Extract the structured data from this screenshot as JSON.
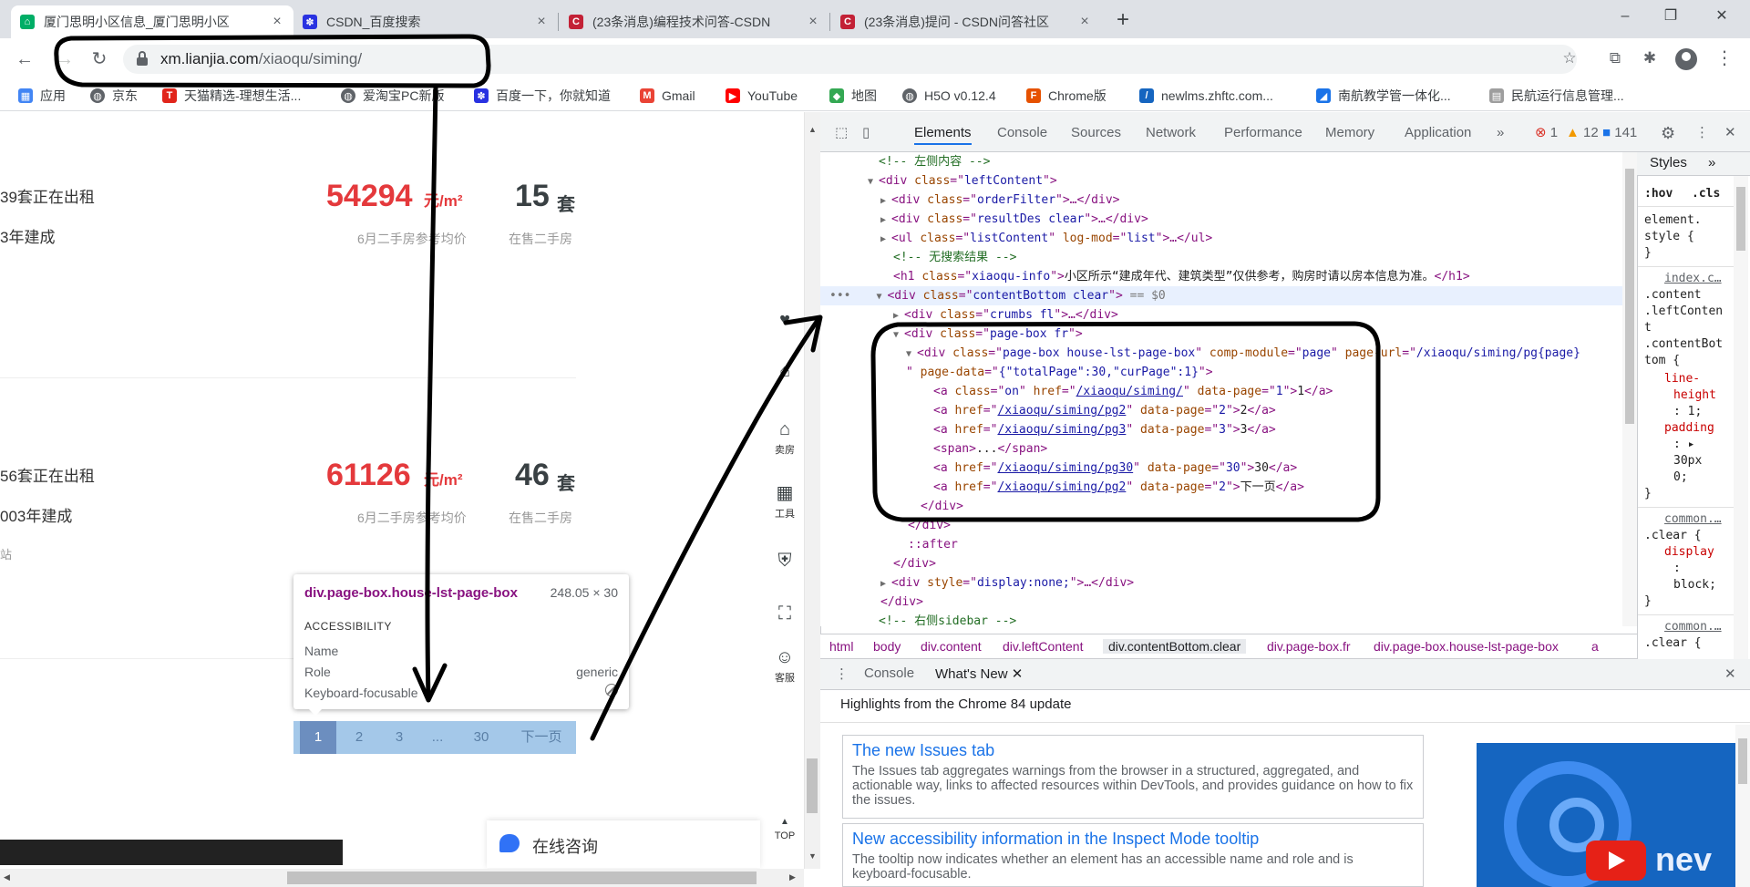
{
  "browser": {
    "tabs": [
      {
        "title": "厦门思明小区信息_厦门思明小区",
        "icon_color": "#00ae66",
        "active": true
      },
      {
        "title": "CSDN_百度搜索",
        "icon_color": "#2932e1",
        "active": false
      },
      {
        "title": "(23条消息)编程技术问答-CSDN",
        "icon_color": "#c32136",
        "active": false
      },
      {
        "title": "(23条消息)提问 - CSDN问答社区",
        "icon_color": "#c32136",
        "active": false
      }
    ],
    "new_tab": "+",
    "win_controls": {
      "minimize": "–",
      "maximize": "❐",
      "close": "✕"
    },
    "nav": {
      "back": "←",
      "forward": "→",
      "reload": "↻"
    },
    "url": {
      "host": "xm.lianjia.com",
      "path": "/xiaoqu/siming/"
    },
    "omnibox_icons": {
      "star": "☆",
      "cast": "⧉",
      "extensions": "✱"
    },
    "menu": "⋮",
    "bookmarks": [
      {
        "label": "应用",
        "icon_color": "#4285f4"
      },
      {
        "label": "京东",
        "icon_color": "#5f6368"
      },
      {
        "label": "天猫精选-理想生活...",
        "icon_color": "#e1251b"
      },
      {
        "label": "爱淘宝PC新版",
        "icon_color": "#5f6368"
      },
      {
        "label": "百度一下，你就知道",
        "icon_color": "#2932e1"
      },
      {
        "label": "Gmail",
        "icon_color": "#ea4335"
      },
      {
        "label": "YouTube",
        "icon_color": "#ff0000"
      },
      {
        "label": "地图",
        "icon_color": "#34a853"
      },
      {
        "label": "H5O v0.12.4",
        "icon_color": "#5f6368"
      },
      {
        "label": "Chrome版",
        "icon_color": "#e65100"
      },
      {
        "label": "newlms.zhftc.com...",
        "icon_color": "#1565c0"
      },
      {
        "label": "南航教学管一体化...",
        "icon_color": "#1a73e8"
      },
      {
        "label": "民航运行信息管理...",
        "icon_color": "#9e9e9e"
      }
    ]
  },
  "page": {
    "listings": [
      {
        "rent": "39套正在出租",
        "year": "3年建成",
        "price": "54294",
        "price_unit": "元/m²",
        "price_label": "6月二手房参考均价",
        "count": "15",
        "count_unit": "套",
        "count_label": "在售二手房"
      },
      {
        "rent": "56套正在出租",
        "year": "003年建成",
        "price": "61126",
        "price_unit": "元/m²",
        "price_label": "6月二手房参考均价",
        "count": "46",
        "count_unit": "套",
        "count_label": "在售二手房",
        "tag": "站"
      }
    ],
    "tooltip": {
      "title": "div.page-box.house-lst-page-box",
      "size": "248.05 × 30",
      "section": "ACCESSIBILITY",
      "name_label": "Name",
      "role_label": "Role",
      "role_value": "generic",
      "focus_label": "Keyboard-focusable"
    },
    "pager": [
      "1",
      "2",
      "3",
      "...",
      "30",
      "下一页"
    ],
    "sidebar": [
      {
        "icon": "♥",
        "label": ""
      },
      {
        "icon": "⌂",
        "label": ""
      },
      {
        "icon": "⌂",
        "label": "卖房"
      },
      {
        "icon": "▦",
        "label": "工具"
      },
      {
        "icon": "⛨",
        "label": ""
      },
      {
        "icon": "⛶",
        "label": ""
      },
      {
        "icon": "☺",
        "label": "客服"
      },
      {
        "icon": "▲",
        "label": "TOP"
      }
    ],
    "chat_label": "在线咨询"
  },
  "devtools": {
    "tabs": [
      "Elements",
      "Console",
      "Sources",
      "Network",
      "Performance",
      "Memory",
      "Application"
    ],
    "more": "»",
    "errors": "1",
    "warnings": "12",
    "info": "141",
    "settings": "⚙",
    "kebab": "⋮",
    "close": "✕",
    "dom": {
      "c1": "<!-- 左侧内容 -->",
      "l2_cls": "leftContent",
      "l3_cls": "orderFilter",
      "l4_cls": "resultDes clear",
      "l5_cls": "listContent",
      "l5_attr": "log-mod",
      "l5_val": "list",
      "c6": "<!-- 无搜索结果 -->",
      "l7_cls": "xiaoqu-info",
      "l7_text": "小区所示“建成年代、建筑类型”仅供参考，购房时请以房本信息为准。",
      "l8_cls": "contentBottom clear",
      "l8_tail": "== $0",
      "l9_cls": "crumbs fl",
      "l10_cls": "page-box fr",
      "l11_cls": "page-box house-lst-page-box",
      "l11_comp": "page",
      "l11_url": "/xiaoqu/siming/pg{page}",
      "l12_data": "{\"totalPage\":30,\"curPage\":1}",
      "a1_cls": "on",
      "a1_href": "/xiaoqu/siming/",
      "a1_page": "1",
      "a1_text": "1",
      "a2_href": "/xiaoqu/siming/pg2",
      "a2_page": "2",
      "a2_text": "2",
      "a3_href": "/xiaoqu/siming/pg3",
      "a3_page": "3",
      "a3_text": "3",
      "span_text": "...",
      "a4_href": "/xiaoqu/siming/pg30",
      "a4_page": "30",
      "a4_text": "30",
      "a5_href": "/xiaoqu/siming/pg2",
      "a5_page": "2",
      "a5_text": "下一页",
      "after": "::after",
      "l22_style": "display:none;",
      "c24": "<!-- 右侧sidebar -->"
    },
    "breadcrumbs": [
      "html",
      "body",
      "div.content",
      "div.leftContent",
      "div.contentBottom.clear",
      "div.page-box.fr",
      "div.page-box.house-lst-page-box",
      "a"
    ],
    "styles": {
      "tabs": [
        "Styles",
        "»"
      ],
      "filter_hov": ":hov",
      "filter_cls": ".cls",
      "element_style_1": "element.",
      "element_style_2": "style {",
      "brace_close": "}",
      "rule1_source": "index.c…",
      "rule1_selector": [
        ".content",
        ".leftConten",
        "t",
        ".contentBot",
        "tom {"
      ],
      "rule1_props": [
        "line-",
        "height",
        ": 1;",
        "padding",
        ": ▸",
        "30px",
        "0;"
      ],
      "rule2_source": "common.…",
      "rule2_selector": ".clear {",
      "rule2_prop": "display",
      "rule2_colon": ":",
      "rule2_val": "block;",
      "rule3_source": "common.…",
      "rule3_selector": ".clear {"
    },
    "drawer": {
      "tabs": [
        "Console",
        "What's New"
      ],
      "headline": "Highlights from the Chrome 84 update",
      "cards": [
        {
          "title": "The new Issues tab",
          "body": "The Issues tab aggregates warnings from the browser in a structured, aggregated, and actionable way, links to affected resources within DevTools, and provides guidance on how to fix the issues."
        },
        {
          "title": "New accessibility information in the Inspect Mode tooltip",
          "body": "The tooltip now indicates whether an element has an accessible name and role and is keyboard-focusable."
        }
      ],
      "video_brand": "nev"
    }
  }
}
